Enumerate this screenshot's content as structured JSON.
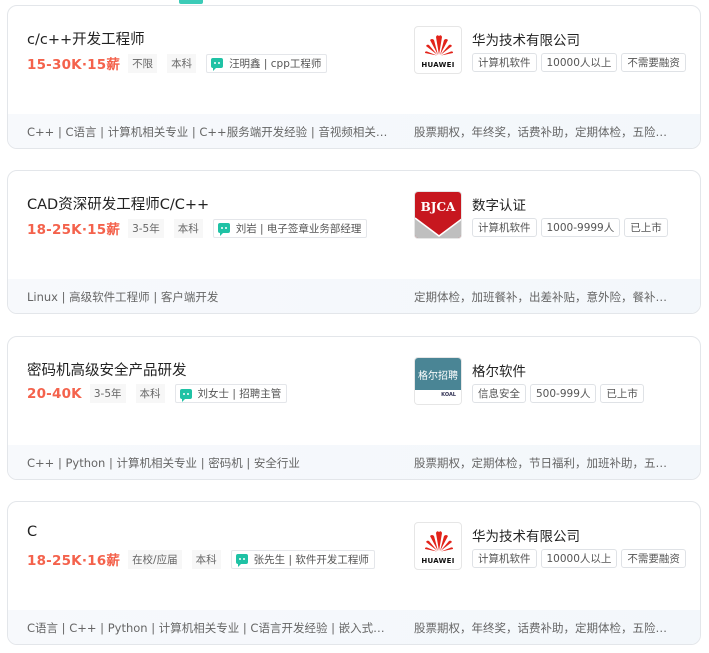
{
  "jobs": [
    {
      "title": "c/c++开发工程师",
      "salary": "15-30K·15薪",
      "experience": "不限",
      "education": "本科",
      "recruiter": "汪明鑫 | cpp工程师",
      "skills": "C++ | C语言 | 计算机相关专业 | C++服务端开发经验 | 音视频相关开发经验",
      "welfare": "股票期权，年终奖，话费补助，定期体检，五险一金，餐补",
      "company": {
        "name": "华为技术有限公司",
        "logo": "huawei-logo",
        "logo_text": "HUAWEI",
        "tags": [
          "计算机软件",
          "10000人以上",
          "不需要融资"
        ]
      }
    },
    {
      "title": "CAD资深研发工程师C/C++",
      "salary": "18-25K·15薪",
      "experience": "3-5年",
      "education": "本科",
      "recruiter": "刘岩 | 电子签章业务部经理",
      "skills": "Linux | 高级软件工程师 | 客户端开发",
      "welfare": "定期体检，加班餐补，出差补贴，意外险，餐补，交通补助",
      "company": {
        "name": "数字认证",
        "logo": "bjca-logo",
        "logo_text": "BJCA",
        "tags": [
          "计算机软件",
          "1000-9999人",
          "已上市"
        ]
      }
    },
    {
      "title": "密码机高级安全产品研发",
      "salary": "20-40K",
      "experience": "3-5年",
      "education": "本科",
      "recruiter": "刘女士 | 招聘主管",
      "skills": "C++ | Python | 计算机相关专业 | 密码机 | 安全行业",
      "welfare": "股票期权，定期体检，节日福利，加班补助，五险一金",
      "company": {
        "name": "格尔软件",
        "logo": "koal-logo",
        "logo_text": "格尔招聘",
        "logo_sub": "KOAL",
        "tags": [
          "信息安全",
          "500-999人",
          "已上市"
        ]
      }
    },
    {
      "title": "C",
      "salary": "18-25K·16薪",
      "experience": "在校/应届",
      "education": "本科",
      "recruiter": "张先生 | 软件开发工程师",
      "skills": "C语言 | C++ | Python | 计算机相关专业 | C语言开发经验 | 嵌入式开发经验",
      "welfare": "股票期权，年终奖，话费补助，定期体检，五险一金，餐补",
      "company": {
        "name": "华为技术有限公司",
        "logo": "huawei-logo",
        "logo_text": "HUAWEI",
        "tags": [
          "计算机软件",
          "10000人以上",
          "不需要融资"
        ]
      }
    }
  ],
  "colors": {
    "salary": "#f4624c",
    "accent": "#1fc2a5",
    "huawei_red": "#e2231a",
    "bjca_red": "#c7171f",
    "koal_teal": "#4a8595"
  }
}
